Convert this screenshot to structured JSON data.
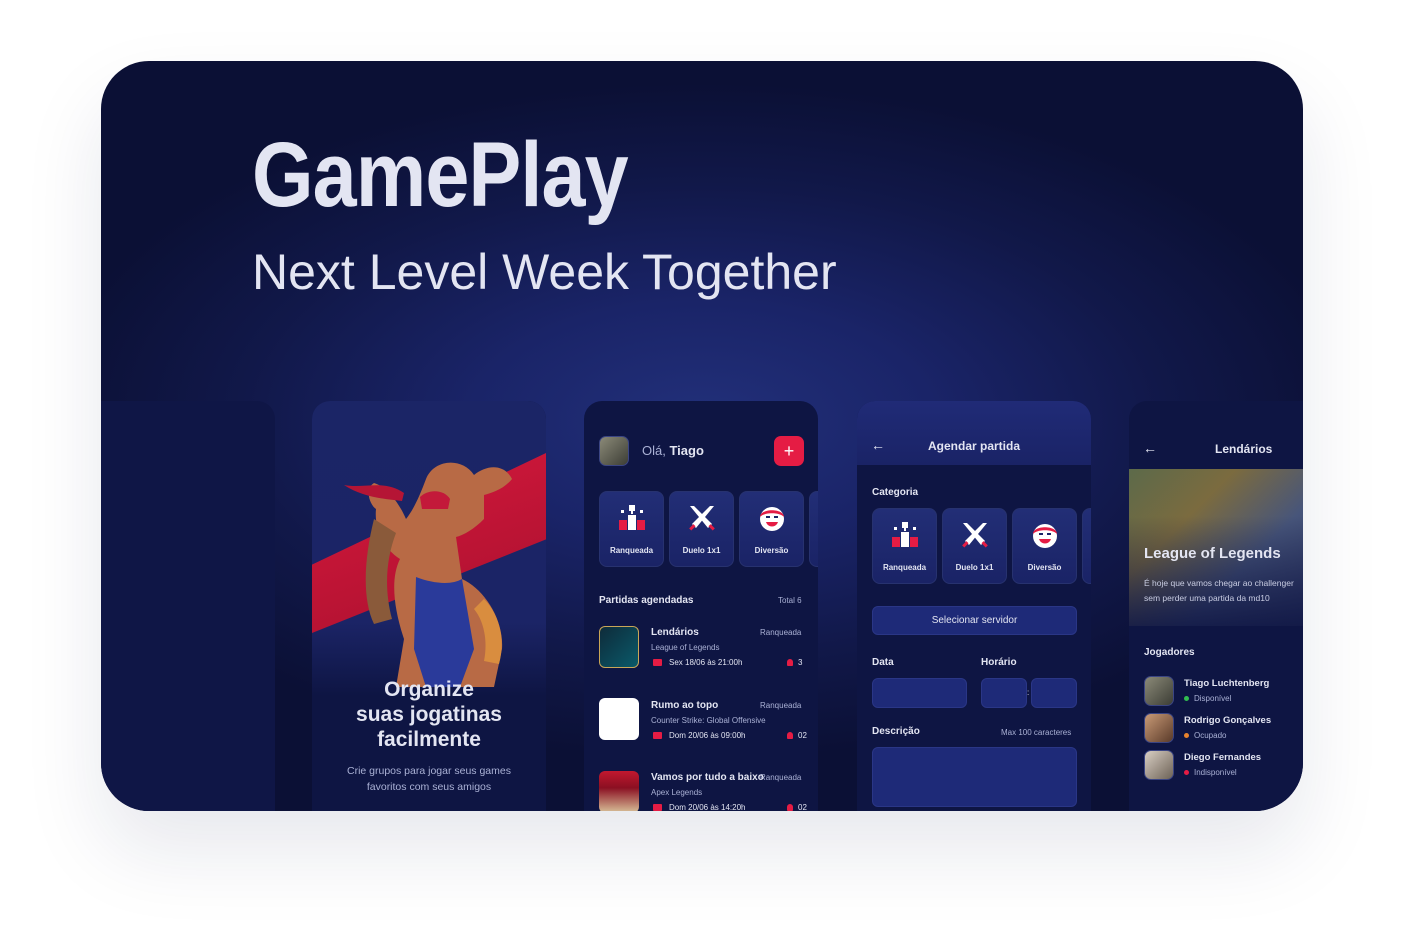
{
  "hero": {
    "title": "GamePlay",
    "subtitle": "Next Level Week Together"
  },
  "onboarding": {
    "headline_line1": "Organize",
    "headline_line2": "suas jogatinas",
    "headline_line3": "facilmente",
    "description_line1": "Crie grupos para jogar seus games",
    "description_line2": "favoritos com seus amigos"
  },
  "home": {
    "greeting": "Olá,",
    "user_name": "Tiago",
    "add_label": "+",
    "categories": [
      {
        "label": "Ranqueada",
        "icon": "ranked-podium-icon"
      },
      {
        "label": "Duelo 1x1",
        "icon": "duel-swords-icon"
      },
      {
        "label": "Diversão",
        "icon": "fun-face-icon"
      }
    ],
    "section_title": "Partidas agendadas",
    "total": "Total 6",
    "matches": [
      {
        "title": "Lendários",
        "category": "Ranqueada",
        "game": "League of Legends",
        "date": "Sex 18/06 às 21:00h",
        "players": "3"
      },
      {
        "title": "Rumo ao topo",
        "category": "Ranqueada",
        "game": "Counter Strike: Global Offensive",
        "date": "Dom 20/06 às 09:00h",
        "players": "02"
      },
      {
        "title": "Vamos por tudo a baixo",
        "category": "Ranqueada",
        "game": "Apex Legends",
        "date": "Dom 20/06 às 14:20h",
        "players": "02"
      }
    ]
  },
  "schedule": {
    "title": "Agendar partida",
    "category_label": "Categoria",
    "categories": [
      "Ranqueada",
      "Duelo 1x1",
      "Diversão"
    ],
    "server_button": "Selecionar servidor",
    "date_label": "Data",
    "time_label": "Horário",
    "time_sep": ":",
    "description_label": "Descrição",
    "description_hint": "Max 100 caracteres"
  },
  "details": {
    "title": "Lendários",
    "banner_title": "League of Legends",
    "banner_desc_line1": "É hoje que vamos chegar ao challenger",
    "banner_desc_line2": "sem perder uma partida da md10",
    "players_label": "Jogadores",
    "players": [
      {
        "name": "Tiago Luchtenberg",
        "status": "Disponível",
        "status_color": "#32bd50"
      },
      {
        "name": "Rodrigo Gonçalves",
        "status": "Ocupado",
        "status_color": "#e8832d"
      },
      {
        "name": "Diego Fernandes",
        "status": "Indisponível",
        "status_color": "#e51c44"
      }
    ]
  },
  "colors": {
    "background": "#111849",
    "accent": "#e51c44",
    "text": "#e3e5f2",
    "muted": "#aab1d5"
  }
}
